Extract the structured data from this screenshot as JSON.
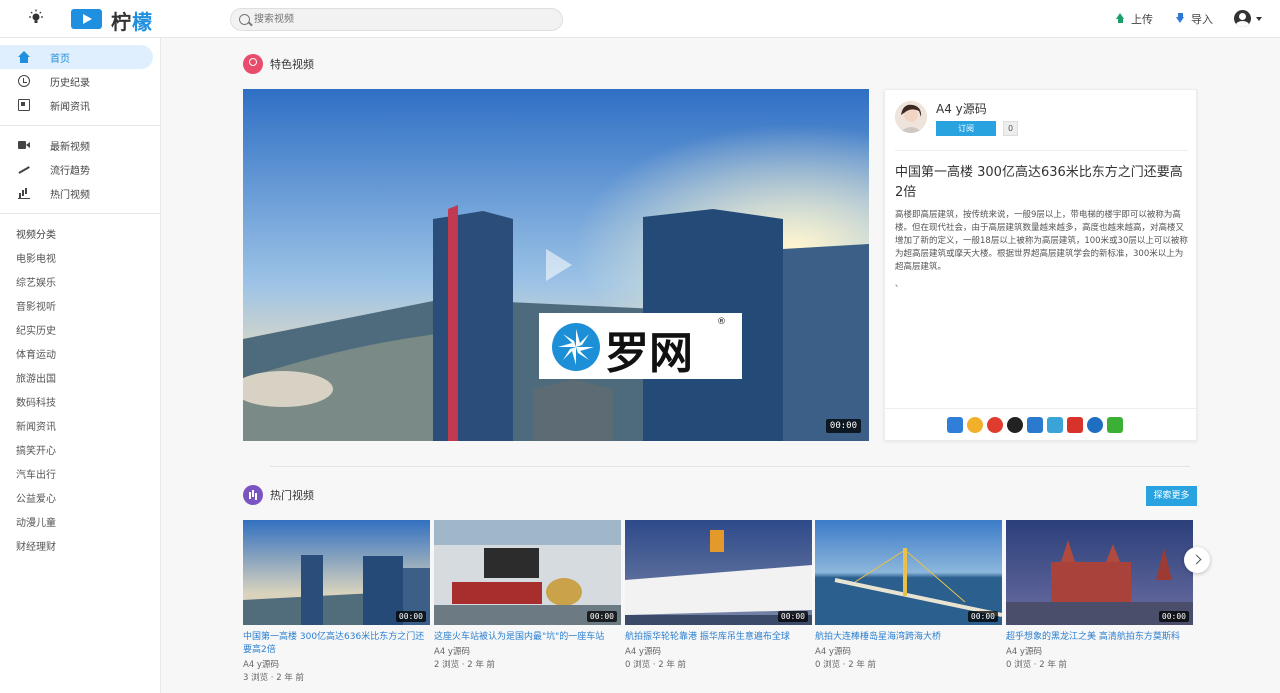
{
  "header": {
    "logo_text_1": "柠",
    "logo_text_2": "檬",
    "search_placeholder": "搜索视频",
    "upload_label": "上传",
    "import_label": "导入"
  },
  "sidebar": {
    "nav": [
      {
        "label": "首页",
        "icon": "home-icon",
        "active": true
      },
      {
        "label": "历史纪录",
        "icon": "history-icon"
      },
      {
        "label": "新闻资讯",
        "icon": "news-icon"
      },
      {
        "label": "最新视频",
        "icon": "video-camera-icon"
      },
      {
        "label": "流行趋势",
        "icon": "trending-icon"
      },
      {
        "label": "热门视频",
        "icon": "bar-chart-icon"
      }
    ],
    "category_title": "视频分类",
    "categories": [
      "电影电视",
      "综艺娱乐",
      "音影视听",
      "纪实历史",
      "体育运动",
      "旅游出国",
      "数码科技",
      "新闻资讯",
      "搞笑开心",
      "汽车出行",
      "公益爱心",
      "动漫儿童",
      "财经理财"
    ]
  },
  "featured": {
    "section_title": "特色视频",
    "duration": "00:00",
    "watermark_text": "罗网",
    "watermark_reg": "®",
    "author": "A4 y源码",
    "subscribe_label": "订阅",
    "subscribe_count": "0",
    "title": "中国第一高楼 300亿高达636米比东方之门还要高2倍",
    "description": "高楼即高层建筑，按传统来说，一般9层以上，带电梯的楼宇即可以被称为高楼。但在现代社会，由于高层建筑数量越来越多，高度也越来越高，对高楼又增加了新的定义，一般18层以上被称为高层建筑，100米或30层以上可以被称为超高层建筑或摩天大楼。根据世界超高层建筑学会的新标准，300米以上为超高层建筑。",
    "extra": "、",
    "share_icons": [
      "plus-share-icon",
      "star-share-icon",
      "weibo-icon",
      "qq-icon",
      "renren-icon",
      "douban-icon",
      "netease-icon",
      "tencent-weibo-icon",
      "wechat-icon"
    ]
  },
  "hot": {
    "section_title": "热门视频",
    "more_label": "探索更多",
    "videos": [
      {
        "title": "中国第一高楼 300亿高达636米比东方之门还要高2倍",
        "author": "A4 y源码",
        "meta": "3 浏览 · 2 年 前",
        "duration": "00:00"
      },
      {
        "title": "这座火车站被认为是国内最\"坑\"的一座车站",
        "author": "A4 y源码",
        "meta": "2 浏览 · 2 年 前",
        "duration": "00:00"
      },
      {
        "title": "航拍振华轮轮靠港 振华库吊生意遍布全球",
        "author": "A4 y源码",
        "meta": "0 浏览 · 2 年 前",
        "duration": "00:00"
      },
      {
        "title": "航拍大连棒棰岛星海湾跨海大桥",
        "author": "A4 y源码",
        "meta": "0 浏览 · 2 年 前",
        "duration": "00:00"
      },
      {
        "title": "超乎想象的黑龙江之美 高清航拍东方莫斯科",
        "author": "A4 y源码",
        "meta": "0 浏览 · 2 年 前",
        "duration": "00:00"
      }
    ]
  },
  "colors": {
    "accent": "#1f8fe0",
    "subscribe": "#29a3e0",
    "link": "#2b7fd0"
  }
}
